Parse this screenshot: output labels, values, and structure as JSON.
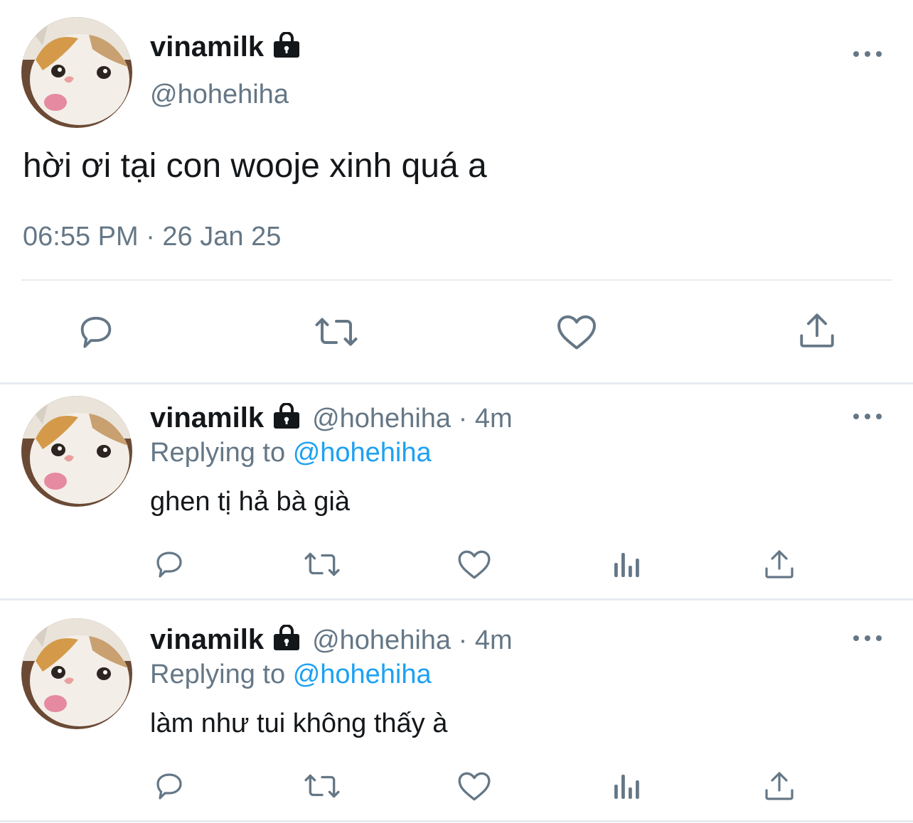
{
  "main_tweet": {
    "display_name": "vinamilk",
    "handle": "@hohehiha",
    "text": "hời ơi tại con wooje xinh quá a",
    "timestamp": "06:55 PM · 26 Jan 25",
    "protected_icon": "lock-icon",
    "actions": [
      "reply-icon",
      "retweet-icon",
      "like-icon",
      "share-icon"
    ]
  },
  "replies": [
    {
      "display_name": "vinamilk",
      "handle": "@hohehiha",
      "separator": "·",
      "time": "4m",
      "replying_prefix": "Replying to",
      "replying_to": "@hohehiha",
      "text": "ghen tị hả bà già",
      "actions": [
        "reply-icon",
        "retweet-icon",
        "like-icon",
        "analytics-icon",
        "share-icon"
      ]
    },
    {
      "display_name": "vinamilk",
      "handle": "@hohehiha",
      "separator": "·",
      "time": "4m",
      "replying_prefix": "Replying to",
      "replying_to": "@hohehiha",
      "text": "làm như tui không thấy à",
      "actions": [
        "reply-icon",
        "retweet-icon",
        "like-icon",
        "analytics-icon",
        "share-icon"
      ]
    }
  ],
  "colors": {
    "text": "#14171a",
    "secondary": "#657786",
    "link": "#1da1f2",
    "divider": "#e6ecf0"
  }
}
